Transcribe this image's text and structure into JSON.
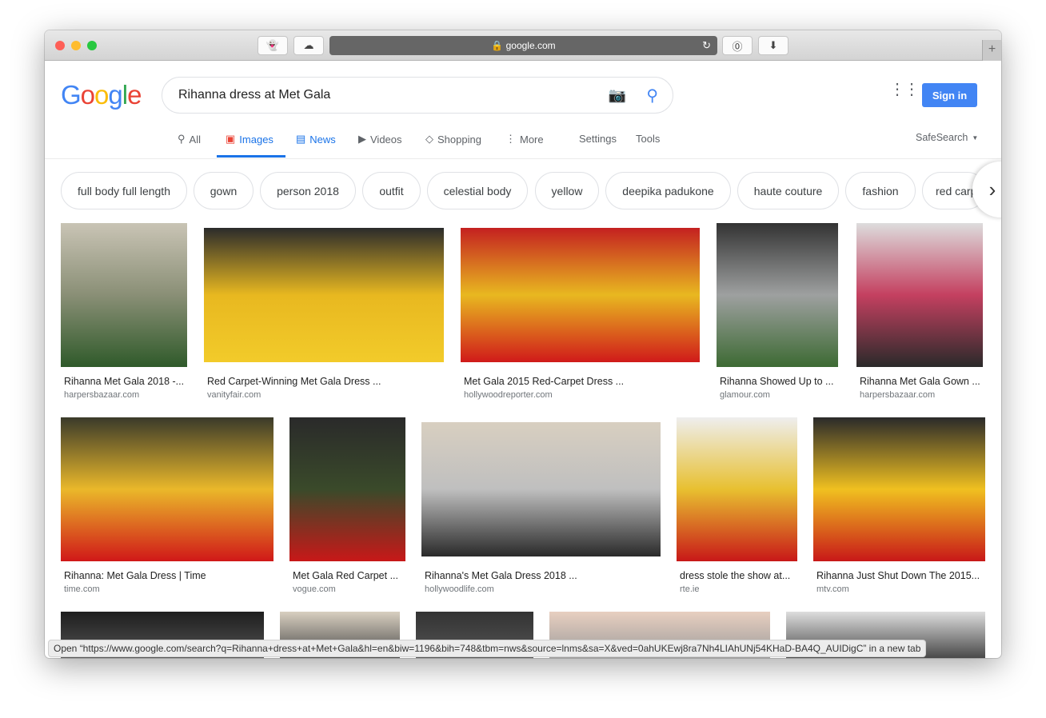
{
  "browser": {
    "url": "google.com",
    "buttons": [
      "ghost-icon",
      "cloud-icon",
      "reload-icon",
      "1password-icon",
      "download-icon",
      "new-tab-icon"
    ]
  },
  "header": {
    "logo": "Google",
    "query": "Rihanna dress at Met Gala",
    "sign_in": "Sign in"
  },
  "tabs": [
    {
      "label": "All",
      "icon": "search-icon"
    },
    {
      "label": "Images",
      "icon": "image-icon",
      "active": true
    },
    {
      "label": "News",
      "icon": "news-icon"
    },
    {
      "label": "Videos",
      "icon": "play-icon"
    },
    {
      "label": "Shopping",
      "icon": "tag-icon"
    },
    {
      "label": "More",
      "icon": "dots-vertical-icon"
    }
  ],
  "tools": {
    "settings": "Settings",
    "tools": "Tools",
    "safesearch": "SafeSearch"
  },
  "chips": [
    "full body full length",
    "gown",
    "person 2018",
    "outfit",
    "celestial body",
    "yellow",
    "deepika padukone",
    "haute couture",
    "fashion",
    "red carpet"
  ],
  "results": [
    {
      "title": "Rihanna Met Gala 2018 -...",
      "source": "harpersbazaar.com"
    },
    {
      "title": "Red Carpet-Winning Met Gala Dress ...",
      "source": "vanityfair.com"
    },
    {
      "title": "Met Gala 2015 Red-Carpet Dress ...",
      "source": "hollywoodreporter.com"
    },
    {
      "title": "Rihanna Showed Up to ...",
      "source": "glamour.com"
    },
    {
      "title": "Rihanna Met Gala Gown ...",
      "source": "harpersbazaar.com"
    },
    {
      "title": "Rihanna: Met Gala Dress | Time",
      "source": "time.com"
    },
    {
      "title": "Met Gala Red Carpet ...",
      "source": "vogue.com"
    },
    {
      "title": "Rihanna's Met Gala Dress 2018 ...",
      "source": "hollywoodlife.com"
    },
    {
      "title": "dress stole the show at...",
      "source": "rte.ie"
    },
    {
      "title": "Rihanna Just Shut Down The 2015...",
      "source": "mtv.com"
    }
  ],
  "status_bar": "Open “https://www.google.com/search?q=Rihanna+dress+at+Met+Gala&hl=en&biw=1196&bih=748&tbm=nws&source=lnms&sa=X&ved=0ahUKEwj8ra7Nh4LIAhUNj54KHaD-BA4Q_AUIDigC” in a new tab"
}
